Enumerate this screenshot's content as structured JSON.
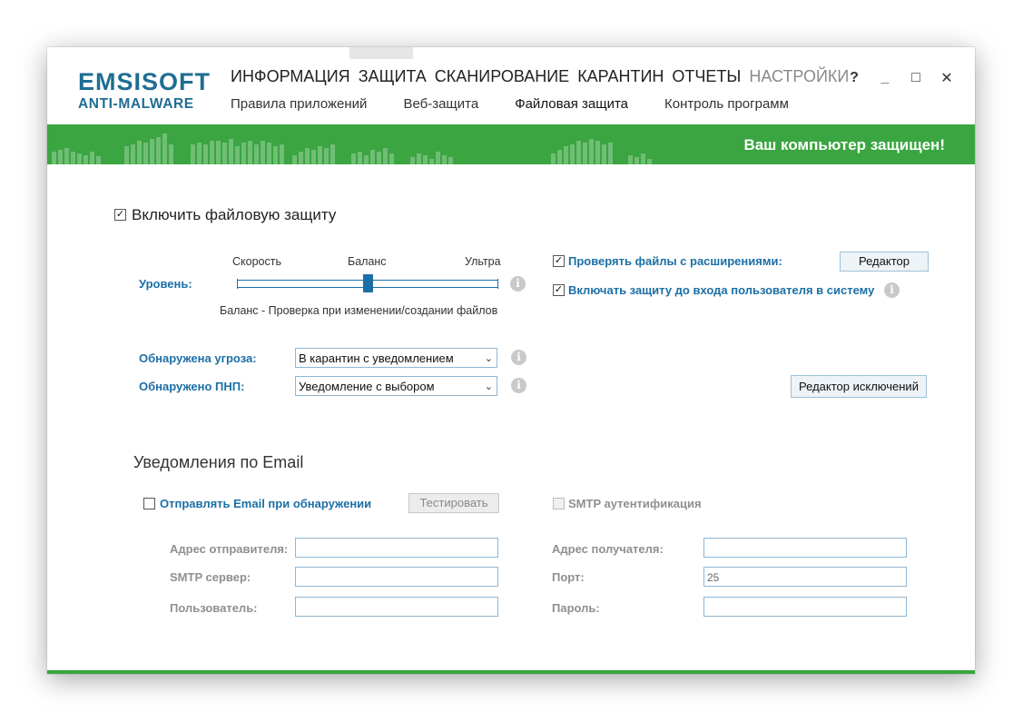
{
  "logo": {
    "main": "EMSISOFT",
    "sub": "ANTI-MALWARE"
  },
  "nav": {
    "main": [
      "ИНФОРМАЦИЯ",
      "ЗАЩИТА",
      "СКАНИРОВАНИЕ",
      "КАРАНТИН",
      "ОТЧЕТЫ",
      "НАСТРОЙКИ"
    ],
    "active_main": "НАСТРОЙКИ",
    "sub": [
      "Правила приложений",
      "Веб-защита",
      "Файловая защита",
      "Контроль программ"
    ],
    "active_sub": "Файловая защита"
  },
  "window_controls": {
    "help": "?",
    "minimize": "_",
    "maximize": "□",
    "close": "✕"
  },
  "status": {
    "text": "Ваш компьютер защищен!",
    "color": "#3aa541"
  },
  "file_protection": {
    "enable_label": "Включить файловую защиту",
    "enabled": true,
    "level": {
      "label": "Уровень:",
      "options": [
        "Скорость",
        "Баланс",
        "Ультра"
      ],
      "selected": "Баланс",
      "value_fraction": 0.5,
      "description": "Баланс - Проверка при изменении/создании файлов"
    },
    "check_extensions": {
      "label": "Проверять файлы с расширениями:",
      "checked": true,
      "button": "Редактор"
    },
    "pre_login": {
      "label": "Включать защиту до входа пользователя в систему",
      "checked": true
    },
    "threat": {
      "label": "Обнаружена угроза:",
      "value": "В карантин с уведомлением"
    },
    "pup": {
      "label": "Обнаружено ПНП:",
      "value": "Уведомление с выбором"
    },
    "exclusions_button": "Редактор исключений"
  },
  "email": {
    "title": "Уведомления по Email",
    "send_label": "Отправлять Email при обнаружении",
    "send_checked": false,
    "test_button": "Тестировать",
    "smtp_auth_label": "SMTP аутентификация",
    "fields": {
      "sender": {
        "label": "Адрес отправителя:",
        "value": ""
      },
      "smtp_server": {
        "label": "SMTP сервер:",
        "value": ""
      },
      "user": {
        "label": "Пользователь:",
        "value": ""
      },
      "recipient": {
        "label": "Адрес получателя:",
        "value": ""
      },
      "port": {
        "label": "Порт:",
        "value": "25"
      },
      "password": {
        "label": "Пароль:",
        "value": ""
      }
    }
  },
  "icons": {
    "info": "info-icon",
    "dropdown": "chevron-down-icon"
  }
}
